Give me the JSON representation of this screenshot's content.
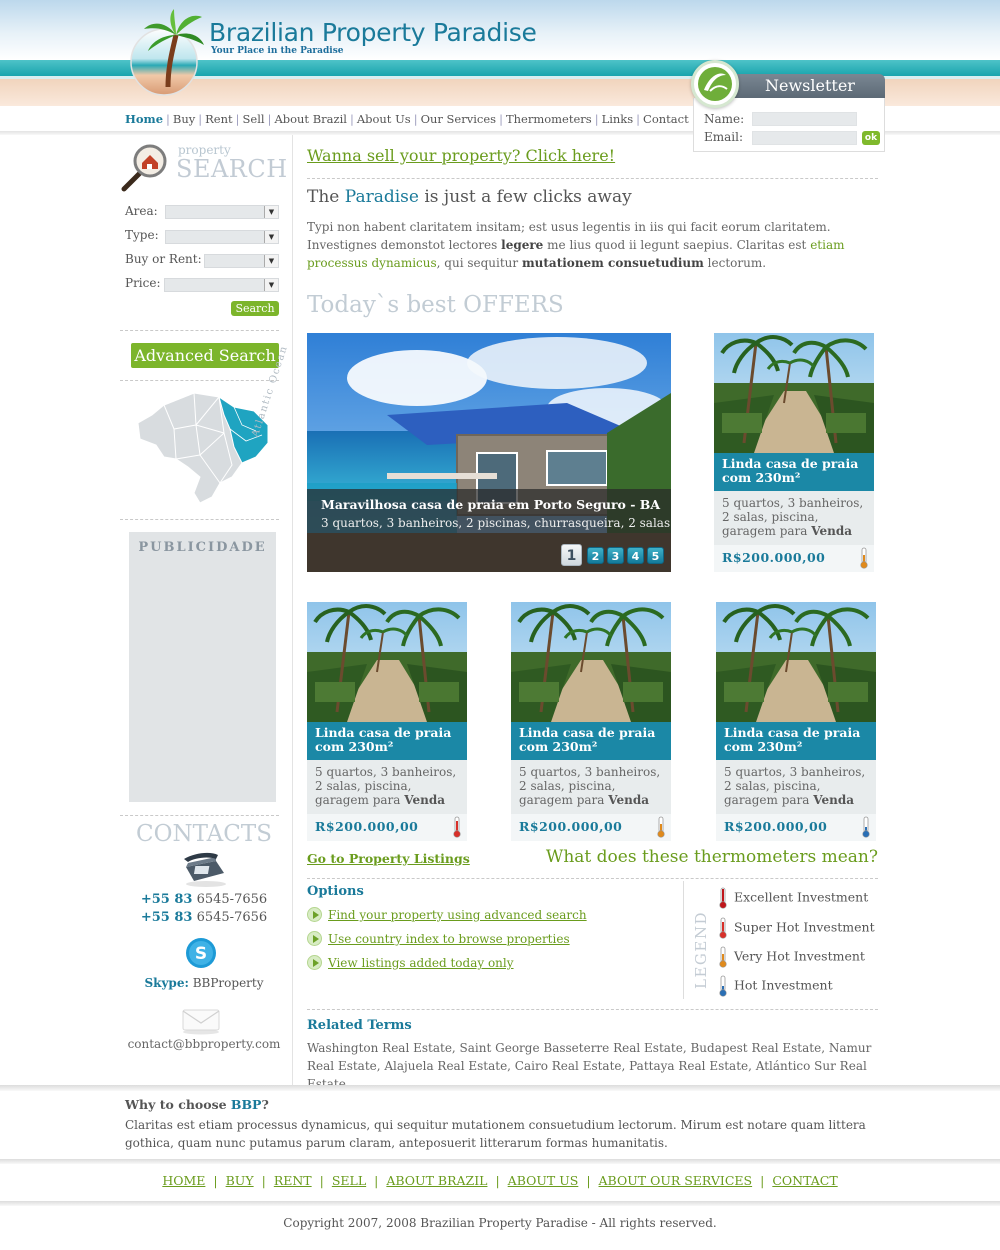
{
  "brand": {
    "title": "Brazilian Property Paradise",
    "tagline": "Your Place in the Paradise"
  },
  "nav": [
    {
      "label": "Home",
      "active": true
    },
    {
      "label": "Buy"
    },
    {
      "label": "Rent"
    },
    {
      "label": "Sell"
    },
    {
      "label": "About Brazil"
    },
    {
      "label": "About Us"
    },
    {
      "label": "Our Services"
    },
    {
      "label": "Thermometers"
    },
    {
      "label": "Links"
    },
    {
      "label": "Contact"
    }
  ],
  "newsletter": {
    "title": "Newsletter",
    "name_label": "Name:",
    "email_label": "Email:",
    "name_value": "",
    "email_value": "",
    "ok_label": "ok"
  },
  "search": {
    "heading_small": "property",
    "heading_big": "SEARCH",
    "area_label": "Area:",
    "type_label": "Type:",
    "buy_rent_label": "Buy or Rent:",
    "price_label": "Price:",
    "search_button": "Search",
    "advanced_button": "Advanced Search",
    "map_label": "Atlantic Ocean"
  },
  "ads": {
    "label": "PUBLICIDADE"
  },
  "contacts": {
    "heading": "CONTACTS",
    "phones": [
      {
        "code": "+55 83",
        "number": "6545-7656"
      },
      {
        "code": "+55 83",
        "number": "6545-7656"
      }
    ],
    "skype_label": "Skype:",
    "skype_user": "BBProperty",
    "email": "contact@bbproperty.com"
  },
  "main": {
    "sell_link": "Wanna sell your property? Click here!",
    "tagline_pre": "The ",
    "tagline_highlight": "Paradise",
    "tagline_post": " is just a few clicks away",
    "intro_1": "Typi non habent claritatem insitam; est usus legentis in iis qui facit eorum claritatem. Investignes demonstot lectores ",
    "intro_b1": "legere",
    "intro_2": " me lius quod ii legunt saepius. Claritas est ",
    "intro_link": "etiam processus dynamicus",
    "intro_3": ", qui sequitur ",
    "intro_b2": "mutationem consuetudium",
    "intro_4": " lectorum.",
    "offers_heading": "Today`s best OFFERS"
  },
  "featured": {
    "title": "Maravilhosa casa de praia em Porto Seguro - BA",
    "desc": "3 quartos, 3 banheiros, 2 piscinas, churrasqueira, 2 salas.",
    "pages": [
      "1",
      "2",
      "3",
      "4",
      "5"
    ],
    "active_page": "1"
  },
  "cards": [
    {
      "title": "Linda casa de praia com 230m²",
      "desc_pre": "5 quartos, 3 banheiros, 2 salas, piscina, garagem para ",
      "desc_bold": "Venda",
      "price": "R$200.000,00",
      "thermometer": "very-hot"
    },
    {
      "title": "Linda casa de praia com 230m²",
      "desc_pre": "5 quartos, 3 banheiros, 2 salas, piscina, garagem para ",
      "desc_bold": "Venda",
      "price": "R$200.000,00",
      "thermometer": "super-hot"
    },
    {
      "title": "Linda casa de praia com 230m²",
      "desc_pre": "5 quartos, 3 banheiros, 2 salas, piscina, garagem para ",
      "desc_bold": "Venda",
      "price": "R$200.000,00",
      "thermometer": "very-hot"
    },
    {
      "title": "Linda casa de praia com 230m²",
      "desc_pre": "5 quartos, 3 banheiros, 2 salas, piscina, garagem para ",
      "desc_bold": "Venda",
      "price": "R$200.000,00",
      "thermometer": "hot"
    }
  ],
  "links": {
    "listings": "Go to Property Listings",
    "thermometers_q": "What does these thermometers mean?"
  },
  "options": {
    "heading": "Options",
    "items": [
      "Find your property using advanced search",
      "Use country index to browse properties",
      "View listings added today only"
    ]
  },
  "legend": {
    "label": "LEGEND",
    "items": [
      {
        "label": "Excellent Investment",
        "color": "#c0161b"
      },
      {
        "label": "Super Hot Investment",
        "color": "#d8302a"
      },
      {
        "label": "Very Hot Investment",
        "color": "#e08a1c"
      },
      {
        "label": "Hot Investment",
        "color": "#2a6fb5"
      }
    ]
  },
  "related": {
    "heading": "Related Terms",
    "text": "Washington Real Estate, Saint George Basseterre Real Estate, Budapest Real Estate, Namur Real Estate, Alajuela Real Estate, Cairo Real Estate, Pattaya Real Estate, Atlántico Sur Real Estate"
  },
  "why": {
    "heading_pre": "Why to choose ",
    "heading_brand": "BBP",
    "heading_post": "?",
    "text": "Claritas est etiam processus dynamicus, qui sequitur mutationem consuetudium lectorum. Mirum est notare quam littera gothica, quam nunc putamus parum claram, anteposuerit litterarum formas humanitatis."
  },
  "footer_nav": [
    "HOME",
    "BUY",
    "RENT",
    "SELL",
    "ABOUT BRAZIL",
    "ABOUT US",
    "ABOUT OUR SERVICES",
    "CONTACT"
  ],
  "copyright": "Copyright 2007, 2008 Brazilian Property Paradise - All rights reserved.",
  "colors": {
    "brand_blue": "#1a7a9a",
    "accent_green": "#7cb52b",
    "card_title_bg": "#1b88a6"
  }
}
